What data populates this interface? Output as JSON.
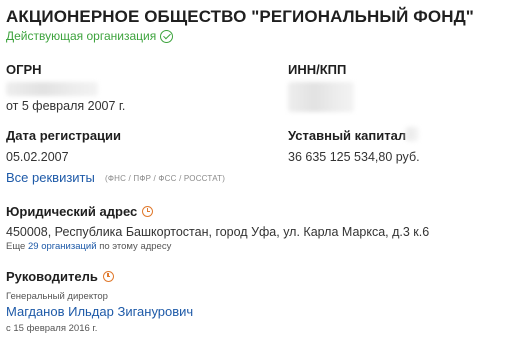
{
  "company": {
    "title": "АКЦИОНЕРНОЕ ОБЩЕСТВО \"РЕГИОНАЛЬНЫЙ ФОНД\"",
    "status": "Действующая организация"
  },
  "ogrn": {
    "label": "ОГРН",
    "date": "от 5 февраля 2007 г."
  },
  "inn_kpp": {
    "label": "ИНН/КПП"
  },
  "registration": {
    "label": "Дата регистрации",
    "value": "05.02.2007"
  },
  "capital": {
    "label": "Уставный капитал",
    "value": "36 635 125 534,80 руб."
  },
  "requisites": {
    "link": "Все реквизиты",
    "sources": "(ФНС / ПФР / ФСС / РОССТАТ)"
  },
  "address": {
    "label": "Юридический адрес",
    "value": "450008, Республика Башкортостан, город Уфа, ул. Карла Маркса, д.3 к.6",
    "more_prefix": "Еще",
    "more_link": "29 организаций",
    "more_suffix": "по этому адресу"
  },
  "director": {
    "label": "Руководитель",
    "position": "Генеральный директор",
    "name": "Магданов Ильдар Зиганурович",
    "since": "с 15 февраля 2016 г."
  },
  "colors": {
    "status_green": "#3da33d",
    "link_blue": "#1e5aa8",
    "clock_orange": "#e07a2e"
  },
  "icons": [
    "check-circle-icon",
    "clock-icon"
  ]
}
